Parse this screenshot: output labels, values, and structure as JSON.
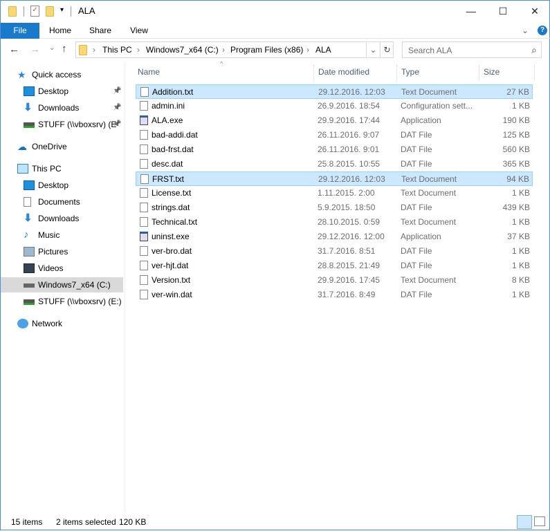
{
  "window": {
    "title": "ALA",
    "minimize": "—",
    "maximize": "☐",
    "close": "✕"
  },
  "ribbon": {
    "tabs": [
      "File",
      "Home",
      "Share",
      "View"
    ],
    "expand": "⌄",
    "help": "?"
  },
  "address": {
    "crumbs": [
      "This PC",
      "Windows7_x64 (C:)",
      "Program Files (x86)",
      "ALA"
    ],
    "separator": "›",
    "refresh": "↻"
  },
  "search": {
    "placeholder": "Search ALA",
    "icon": "⌕"
  },
  "nav_buttons": {
    "back": "←",
    "forward": "→",
    "recent": "⌄",
    "up": "↑"
  },
  "sidebar": [
    {
      "label": "Quick access",
      "icon": "star-icon",
      "level": 0
    },
    {
      "label": "Desktop",
      "icon": "desktop-icon",
      "level": 1,
      "pinned": true
    },
    {
      "label": "Downloads",
      "icon": "download-icon",
      "level": 1,
      "pinned": true
    },
    {
      "label": "STUFF (\\\\vboxsrv) (E",
      "icon": "network-drive-icon",
      "level": 1,
      "pinned": true
    },
    {
      "label": "OneDrive",
      "icon": "cloud-icon",
      "level": 0
    },
    {
      "label": "This PC",
      "icon": "computer-icon",
      "level": 0
    },
    {
      "label": "Desktop",
      "icon": "desktop-icon",
      "level": 1
    },
    {
      "label": "Documents",
      "icon": "documents-icon",
      "level": 1
    },
    {
      "label": "Downloads",
      "icon": "download-icon",
      "level": 1
    },
    {
      "label": "Music",
      "icon": "music-icon",
      "level": 1
    },
    {
      "label": "Pictures",
      "icon": "pictures-icon",
      "level": 1
    },
    {
      "label": "Videos",
      "icon": "videos-icon",
      "level": 1
    },
    {
      "label": "Windows7_x64 (C:)",
      "icon": "drive-icon",
      "level": 1,
      "selected": true
    },
    {
      "label": "STUFF (\\\\vboxsrv) (E:)",
      "icon": "network-drive-icon",
      "level": 1
    },
    {
      "label": "Network",
      "icon": "network-icon",
      "level": 0
    }
  ],
  "columns": [
    "Name",
    "Date modified",
    "Type",
    "Size"
  ],
  "files": [
    {
      "name": "Addition.txt",
      "date": "29.12.2016. 12:03",
      "type": "Text Document",
      "size": "27 KB",
      "selected": true
    },
    {
      "name": "admin.ini",
      "date": "26.9.2016. 18:54",
      "type": "Configuration sett...",
      "size": "1 KB"
    },
    {
      "name": "ALA.exe",
      "date": "29.9.2016. 17:44",
      "type": "Application",
      "size": "190 KB"
    },
    {
      "name": "bad-addi.dat",
      "date": "26.11.2016. 9:07",
      "type": "DAT File",
      "size": "125 KB"
    },
    {
      "name": "bad-frst.dat",
      "date": "26.11.2016. 9:01",
      "type": "DAT File",
      "size": "560 KB"
    },
    {
      "name": "desc.dat",
      "date": "25.8.2015. 10:55",
      "type": "DAT File",
      "size": "365 KB"
    },
    {
      "name": "FRST.txt",
      "date": "29.12.2016. 12:03",
      "type": "Text Document",
      "size": "94 KB",
      "selected": true
    },
    {
      "name": "License.txt",
      "date": "1.11.2015. 2:00",
      "type": "Text Document",
      "size": "1 KB"
    },
    {
      "name": "strings.dat",
      "date": "5.9.2015. 18:50",
      "type": "DAT File",
      "size": "439 KB"
    },
    {
      "name": "Technical.txt",
      "date": "28.10.2015. 0:59",
      "type": "Text Document",
      "size": "1 KB"
    },
    {
      "name": "uninst.exe",
      "date": "29.12.2016. 12:00",
      "type": "Application",
      "size": "37 KB"
    },
    {
      "name": "ver-bro.dat",
      "date": "31.7.2016. 8:51",
      "type": "DAT File",
      "size": "1 KB"
    },
    {
      "name": "ver-hjt.dat",
      "date": "28.8.2015. 21:49",
      "type": "DAT File",
      "size": "1 KB"
    },
    {
      "name": "Version.txt",
      "date": "29.9.2016. 17:45",
      "type": "Text Document",
      "size": "8 KB"
    },
    {
      "name": "ver-win.dat",
      "date": "31.7.2016. 8:49",
      "type": "DAT File",
      "size": "1 KB"
    }
  ],
  "status": {
    "count": "15 items",
    "selection": "2 items selected",
    "size": "120 KB"
  }
}
